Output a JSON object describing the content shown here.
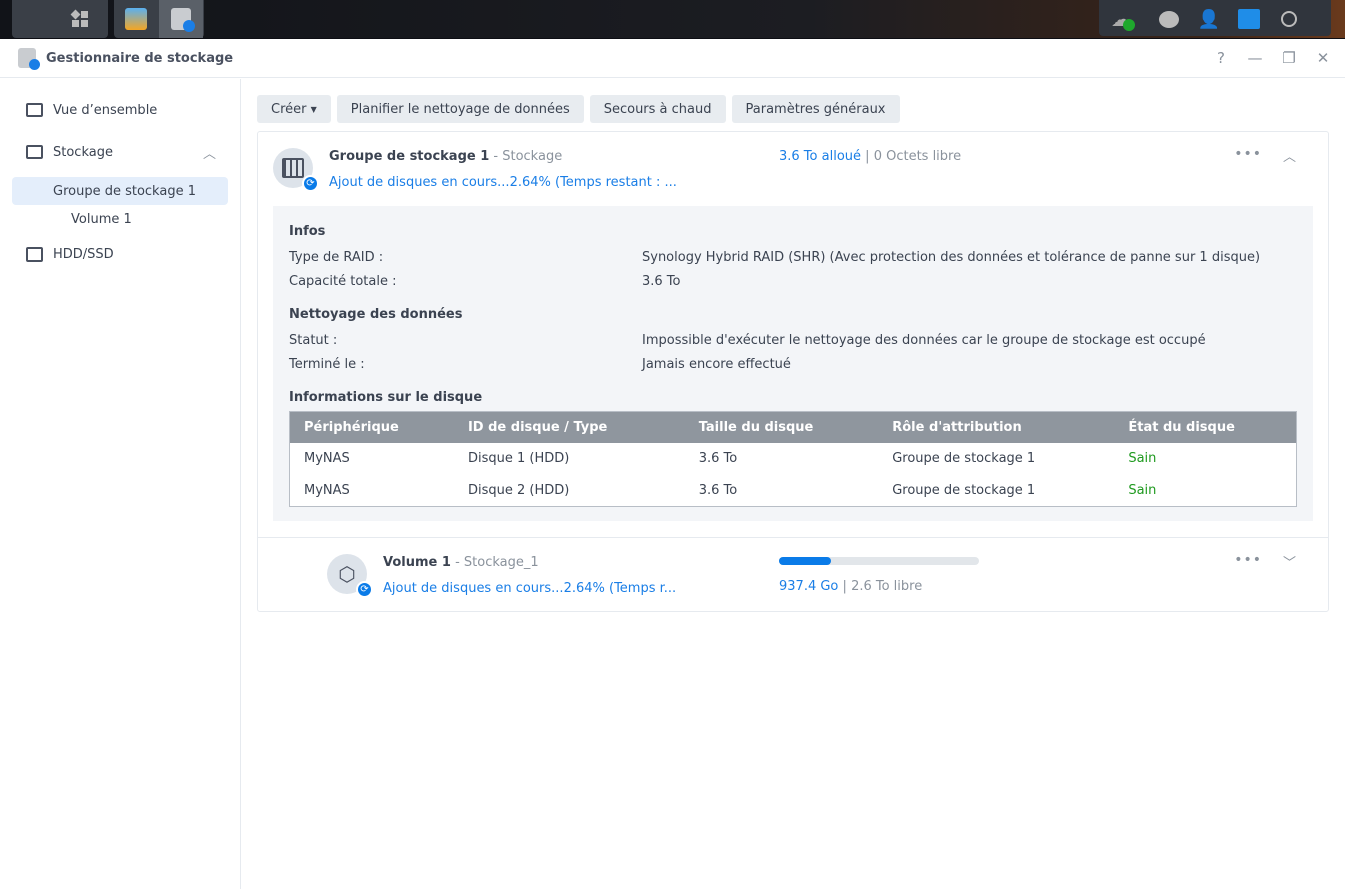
{
  "taskbar": {
    "apps": [
      "main-menu",
      "package-center",
      "storage-manager"
    ],
    "tray": [
      "cloud-sync-ok",
      "messages",
      "user",
      "widgets",
      "search"
    ]
  },
  "window": {
    "title": "Gestionnaire de stockage",
    "controls": {
      "help": "?",
      "minimize": "—",
      "restore": "❐",
      "close": "✕"
    }
  },
  "sidebar": {
    "items": [
      {
        "label": "Vue d’ensemble"
      },
      {
        "label": "Stockage"
      },
      {
        "label": "Groupe de stockage 1"
      },
      {
        "label": "Volume 1"
      },
      {
        "label": "HDD/SSD"
      }
    ]
  },
  "toolbar": {
    "create": "Créer",
    "schedule": "Planifier le nettoyage de données",
    "hotspare": "Secours à chaud",
    "settings": "Paramètres généraux"
  },
  "pool": {
    "name": "Groupe de stockage 1",
    "type": "- Stockage",
    "status": "Ajout de disques en cours...2.64% (Temps restant : ...",
    "allocated": "3.6 To alloué",
    "free": "0 Octets libre",
    "infos_title": "Infos",
    "raid_label": "Type de RAID :",
    "raid_value": "Synology Hybrid RAID (SHR) (Avec protection des données et tolérance de panne sur 1 disque)",
    "capacity_label": "Capacité totale :",
    "capacity_value": "3.6 To",
    "scrub_title": "Nettoyage des données",
    "status_label": "Statut :",
    "status_value": "Impossible d'exécuter le nettoyage des données car le groupe de stockage est occupé",
    "done_label": "Terminé le :",
    "done_value": "Jamais encore effectué",
    "disk_title": "Informations sur le disque",
    "columns": [
      "Périphérique",
      "ID de disque / Type",
      "Taille du disque",
      "Rôle d'attribution",
      "État du disque"
    ],
    "disks": [
      [
        "MyNAS",
        "Disque 1 (HDD)",
        "3.6 To",
        "Groupe de stockage 1",
        "Sain"
      ],
      [
        "MyNAS",
        "Disque 2 (HDD)",
        "3.6 To",
        "Groupe de stockage 1",
        "Sain"
      ]
    ]
  },
  "volume": {
    "name": "Volume 1",
    "type": "- Stockage_1",
    "status": "Ajout de disques en cours...2.64% (Temps r...",
    "used": "937.4 Go",
    "free": "2.6 To libre",
    "usage_percent": 26
  },
  "colors": {
    "accent": "#1a7ee6",
    "healthy": "#1f9a1f"
  }
}
